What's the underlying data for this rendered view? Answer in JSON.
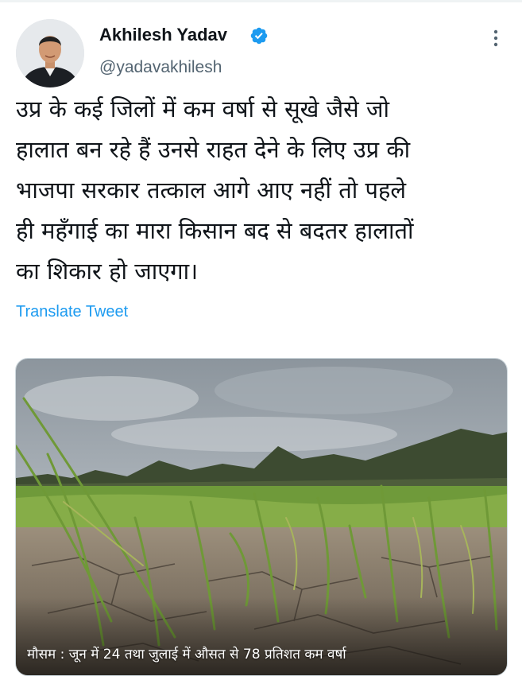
{
  "tweet": {
    "author": {
      "name": "Akhilesh Yadav",
      "handle": "@yadavakhilesh",
      "verified": true
    },
    "text": "उप्र के कई जिलों में कम वर्षा से सूखे जैसे जो हालात बन रहे हैं उनसे राहत देने के लिए उप्र की भाजपा सरकार तत्काल आगे आए नहीं तो पहले ही महँगाई का मारा किसान बद से बदतर हालातों का शिकार हो जाएगा।",
    "text_lines": [
      "उप्र के कई जिलों में कम वर्षा से सूखे जैसे जो",
      "हालात बन रहे हैं उनसे राहत देने के लिए उप्र की",
      "भाजपा सरकार तत्काल आगे आए नहीं तो पहले",
      "ही महँगाई का मारा किसान बद से बदतर हालातों",
      "का शिकार हो जाएगा।"
    ],
    "translate_label": "Translate Tweet",
    "media": {
      "caption": "मौसम : जून में 24 तथा जुलाई में औसत से 78 प्रतिशत कम वर्षा"
    }
  },
  "icons": {
    "verified": "verified-badge-icon",
    "more": "more-options-icon"
  },
  "colors": {
    "link": "#1d9bf0",
    "verified": "#1d9bf0",
    "text": "#0f1419",
    "secondary": "#536471"
  }
}
